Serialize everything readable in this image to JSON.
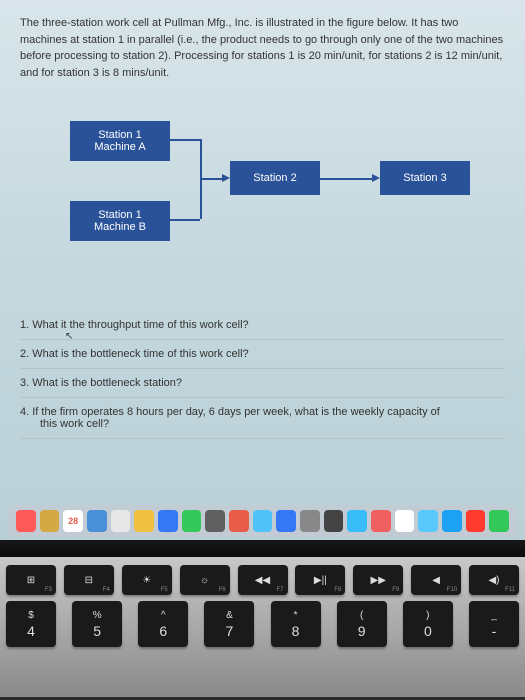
{
  "problem": {
    "intro": "The three-station work cell at Pullman Mfg., Inc. is illustrated in the figure below. It has two machines at station 1 in parallel (i.e., the product needs to go through only one of the two machines before processing to station 2). Processing for stations 1 is 20 min/unit, for stations 2 is 12 min/unit, and for station 3 is 8 mins/unit."
  },
  "stations": {
    "s1a_line1": "Station 1",
    "s1a_line2": "Machine A",
    "s1b_line1": "Station 1",
    "s1b_line2": "Machine B",
    "s2": "Station 2",
    "s3": "Station 3"
  },
  "questions": {
    "q1": "1. What it the throughput time of this work cell?",
    "q2": "2. What is the bottleneck time of this work cell?",
    "q3": "3. What is the bottleneck station?",
    "q4": "4. If the firm operates 8 hours per day, 6 days per week, what is the weekly capacity of",
    "q4b": "this work cell?"
  },
  "dock_colors": [
    "#ff5a5a",
    "#d4a843",
    "#5a9fd4",
    "#4a90d9",
    "#e8e8e8",
    "#f0c040",
    "#3478f6",
    "#34c759",
    "#606060",
    "#e85d4a",
    "#4fc3f7",
    "#3478f6",
    "#888",
    "#444",
    "#38bdf8",
    "#f06060",
    "#fff",
    "#5ac8fa",
    "#1da1f2",
    "#ff3b30",
    "#34c759"
  ],
  "calendar_badge": "28",
  "fkeys": [
    {
      "icon": "⊞",
      "label": "F3"
    },
    {
      "icon": "⊟",
      "label": "F4"
    },
    {
      "icon": "☀",
      "label": "F5"
    },
    {
      "icon": "☼",
      "label": "F6"
    },
    {
      "icon": "◀◀",
      "label": "F7"
    },
    {
      "icon": "▶||",
      "label": "F8"
    },
    {
      "icon": "▶▶",
      "label": "F9"
    },
    {
      "icon": "◀",
      "label": "F10"
    },
    {
      "icon": "◀)",
      "label": "F11"
    }
  ],
  "numkeys": [
    {
      "top": "$",
      "bottom": "4"
    },
    {
      "top": "%",
      "bottom": "5"
    },
    {
      "top": "^",
      "bottom": "6"
    },
    {
      "top": "&",
      "bottom": "7"
    },
    {
      "top": "*",
      "bottom": "8"
    },
    {
      "top": "(",
      "bottom": "9"
    },
    {
      "top": ")",
      "bottom": "0"
    },
    {
      "top": "_",
      "bottom": "-"
    }
  ]
}
